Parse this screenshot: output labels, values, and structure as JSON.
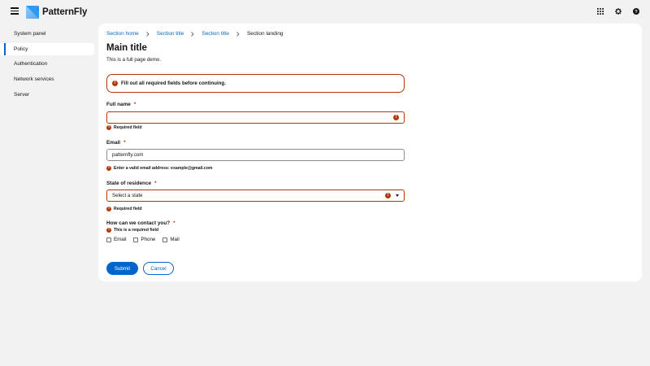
{
  "brand": {
    "name": "PatternFly"
  },
  "colors": {
    "accent": "#0066cc",
    "danger": "#b1380b",
    "background": "#f2f2f2"
  },
  "masthead": {
    "icons": [
      "grid-icon",
      "gear-icon",
      "help-icon"
    ]
  },
  "sidebar": {
    "items": [
      {
        "label": "System panel",
        "active": false
      },
      {
        "label": "Policy",
        "active": true
      },
      {
        "label": "Authentication",
        "active": false
      },
      {
        "label": "Network services",
        "active": false
      },
      {
        "label": "Server",
        "active": false
      }
    ]
  },
  "breadcrumb": [
    "Section home",
    "Section title",
    "Section title",
    "Section landing"
  ],
  "page": {
    "title": "Main title",
    "description": "This is a full page demo."
  },
  "alert": {
    "text": "Fill out all required fields before continuing."
  },
  "form": {
    "full_name": {
      "label": "Full name",
      "required": "*",
      "value": "",
      "helper": "Required field"
    },
    "email": {
      "label": "Email",
      "required": "*",
      "value": "patternfly.com",
      "helper": "Enter a valid email address: example@gmail.com"
    },
    "state": {
      "label": "State of residence",
      "required": "*",
      "selected": "Select a state",
      "helper": "Required field"
    },
    "contact": {
      "label": "How can we contact you?",
      "required": "*",
      "helper": "This is a required field",
      "options": [
        "Email",
        "Phone",
        "Mail"
      ]
    },
    "submit_label": "Submit",
    "cancel_label": "Cancel"
  }
}
